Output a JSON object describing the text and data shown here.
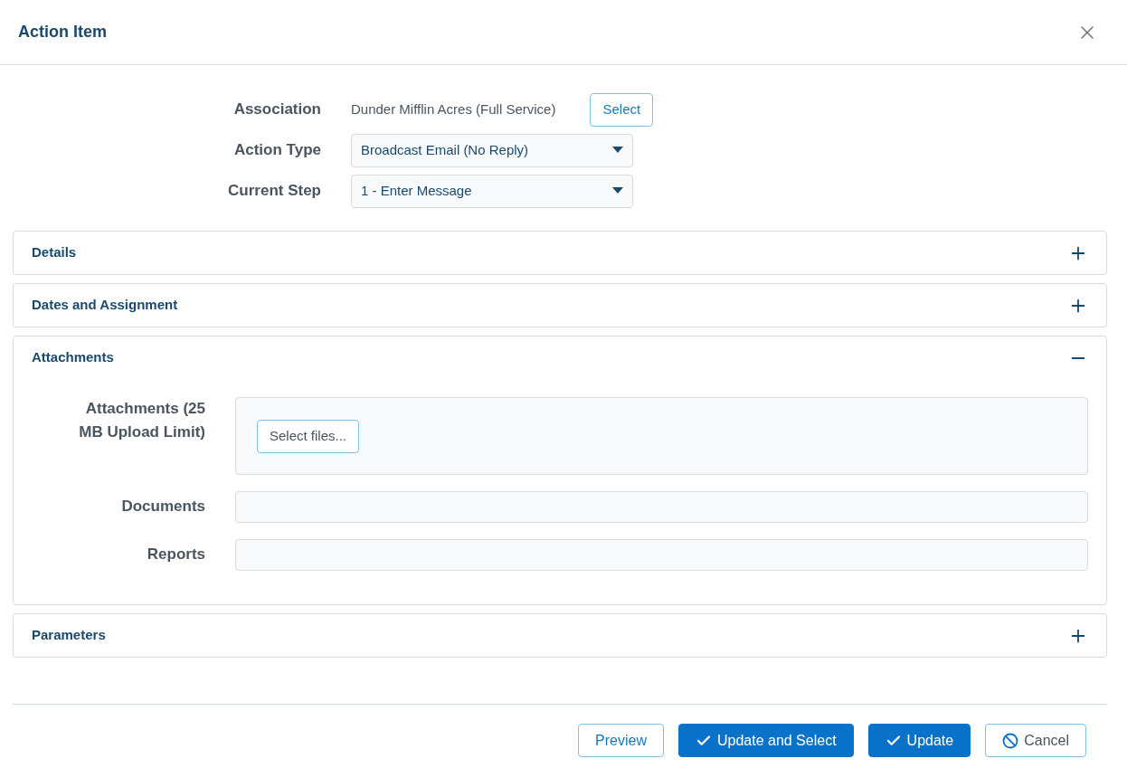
{
  "dialog": {
    "title": "Action Item"
  },
  "form": [
    {
      "label": "Association",
      "kind": "text",
      "value": "Dunder Mifflin Acres (Full Service)",
      "button": "Select"
    },
    {
      "label": "Action Type",
      "kind": "dropdown",
      "value": "Broadcast Email (No Reply)"
    },
    {
      "label": "Current Step",
      "kind": "dropdown",
      "value": "1 - Enter Message"
    }
  ],
  "sections": [
    {
      "title": "Details",
      "expanded": false
    },
    {
      "title": "Dates and Assignment",
      "expanded": false
    },
    {
      "title": "Attachments",
      "expanded": true,
      "fields": [
        {
          "label": "Attachments (25 MB Upload Limit)",
          "kind": "upload",
          "button": "Select files..."
        },
        {
          "label": "Documents",
          "kind": "field"
        },
        {
          "label": "Reports",
          "kind": "field"
        }
      ]
    },
    {
      "title": "Parameters",
      "expanded": false
    }
  ],
  "buttons": [
    {
      "label": "Preview",
      "kind": "preview"
    },
    {
      "label": "Update and Select",
      "kind": "confirm"
    },
    {
      "label": "Update",
      "kind": "confirm"
    },
    {
      "label": "Cancel",
      "kind": "cancel"
    }
  ]
}
